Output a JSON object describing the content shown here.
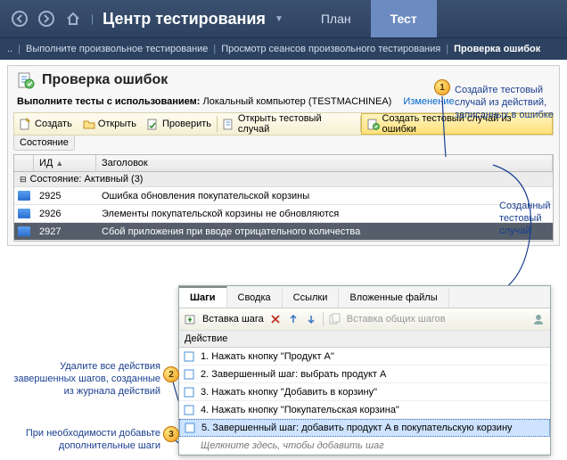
{
  "topbar": {
    "title": "Центр тестирования",
    "tab_plan": "План",
    "tab_test": "Тест"
  },
  "crumbs": {
    "dots": "..",
    "c1": "Выполните произвольное тестирование",
    "c2": "Просмотр сеансов произвольного тестирования",
    "c3": "Проверка ошибок"
  },
  "panel": {
    "title": "Проверка ошибок",
    "run_label": "Выполните тесты с использованием:",
    "run_value": "Локальный компьютер (TESTMACHINEA)",
    "change": "Изменение"
  },
  "toolbar": {
    "create": "Создать",
    "open": "Открыть",
    "verify": "Проверить",
    "open_tc": "Открыть тестовый случай",
    "create_tc": "Создать тестовый случай из ошибки"
  },
  "statebar": "Состояние",
  "grid": {
    "col_id": "ИД",
    "col_title": "Заголовок",
    "group": "Состояние: Активный (3)",
    "rows": [
      {
        "id": "2925",
        "title": "Ошибка обновления покупательской корзины"
      },
      {
        "id": "2926",
        "title": "Элементы покупательской корзины не обновляются"
      },
      {
        "id": "2927",
        "title": "Сбой приложения при вводе отрицательного количества"
      }
    ]
  },
  "steps": {
    "tabs": {
      "steps": "Шаги",
      "summary": "Сводка",
      "links": "Ссылки",
      "attach": "Вложенные файлы"
    },
    "tool": {
      "insert": "Вставка шага",
      "shared": "Вставка общих шагов"
    },
    "col": "Действие",
    "rows": [
      "1. Нажать кнопку \"Продукт A\"",
      "2. Завершенный шаг: выбрать продукт A",
      "3. Нажать кнопку \"Добавить в корзину\"",
      "4. Нажать кнопку \"Покупательская корзина\"",
      "5. Завершенный шаг: добавить продукт A в покупательскую корзину"
    ],
    "add": "Щелкните здесь, чтобы добавить шаг"
  },
  "ann": {
    "a1": "Создайте тестовый случай из действий, записанных в ошибке",
    "a_created": "Созданный тестовый случай",
    "a2": "Удалите все действия завершенных шагов, созданные из журнала действий",
    "a3": "При необходимости добавьте дополнительные шаги"
  }
}
